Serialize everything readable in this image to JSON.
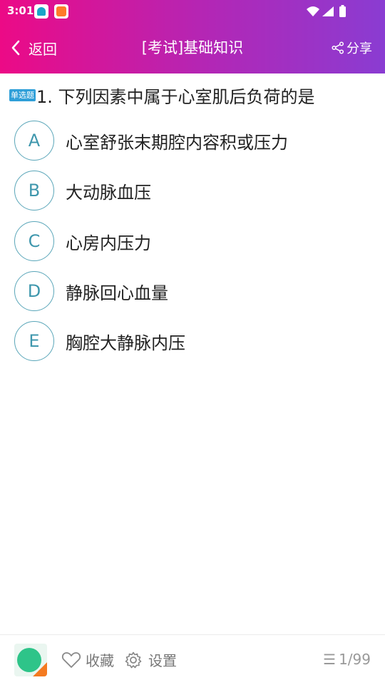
{
  "status_bar": {
    "time": "3:01"
  },
  "header": {
    "back_label": "返回",
    "title": "[考试]基础知识",
    "share_label": "分享",
    "gradient_colors": [
      "#ec0a86",
      "#8a3cd2"
    ]
  },
  "question": {
    "type_badge": "单选题",
    "text": "1. 下列因素中属于心室肌后负荷的是"
  },
  "options": [
    {
      "letter": "A",
      "text": "心室舒张末期腔内容积或压力"
    },
    {
      "letter": "B",
      "text": "大动脉血压"
    },
    {
      "letter": "C",
      "text": "心房内压力"
    },
    {
      "letter": "D",
      "text": "静脉回心血量"
    },
    {
      "letter": "E",
      "text": "胸腔大静脉内压"
    }
  ],
  "bottom_bar": {
    "favorite_label": "收藏",
    "settings_label": "设置",
    "progress": "1/99"
  },
  "icons": {
    "back": "chevron-left-icon",
    "share": "share-icon",
    "favorite": "heart-outline-icon",
    "settings": "gear-icon",
    "list": "list-icon"
  },
  "colors": {
    "option_circle": "#5aa6b9",
    "badge": "#2f9fd8"
  }
}
